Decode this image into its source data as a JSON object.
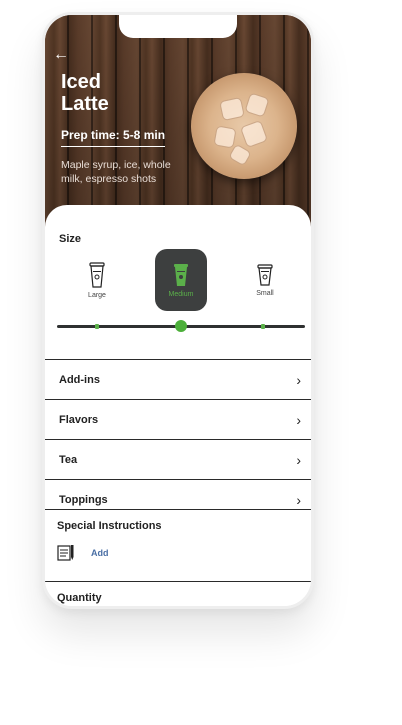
{
  "product": {
    "title": "Iced Latte",
    "prep_time": "Prep time: 5-8  min",
    "description": "Maple syrup, ice, whole milk, espresso shots"
  },
  "icons": {
    "back": "back-arrow-icon",
    "cup": "cup-icon",
    "chevron": "chevron-right-icon",
    "notes": "notes-icon"
  },
  "size": {
    "heading": "Size",
    "options": [
      {
        "label": "Large"
      },
      {
        "label": "Medium",
        "selected": true
      },
      {
        "label": "Small"
      }
    ],
    "slider_value": "Medium"
  },
  "options": [
    {
      "label": "Add-ins"
    },
    {
      "label": "Flavors"
    },
    {
      "label": "Tea"
    },
    {
      "label": "Toppings"
    }
  ],
  "special_instructions": {
    "heading": "Special Instructions",
    "add_label": "Add"
  },
  "quantity": {
    "heading": "Quantity"
  },
  "colors": {
    "accent": "#4caf3a",
    "selected_bg": "#3d3f3f",
    "link": "#4a6fa5"
  }
}
